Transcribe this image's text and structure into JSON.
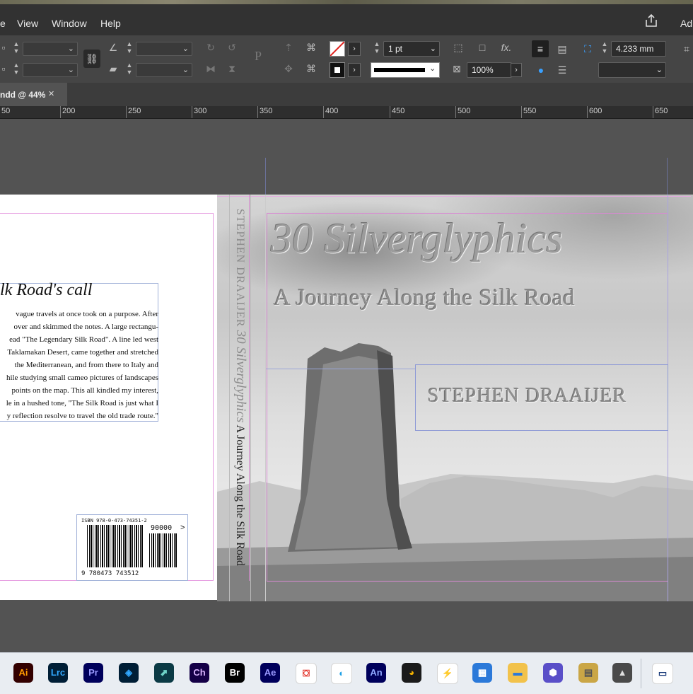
{
  "menu": {
    "item_e": "e",
    "view": "View",
    "window": "Window",
    "help": "Help",
    "ad": "Ad"
  },
  "control": {
    "stroke_weight": "1 pt",
    "opacity": "100%",
    "dimension": "4.233 mm"
  },
  "document_tab": {
    "title": "ndd @ 44%",
    "close": "✕"
  },
  "ruler": {
    "labels": [
      "50",
      "200",
      "250",
      "300",
      "350",
      "400",
      "450",
      "500",
      "550",
      "600",
      "650"
    ]
  },
  "back_cover": {
    "heading": "lk Road's call",
    "lines": [
      "vague travels at once took on a purpose. After",
      "over and skimmed the notes. A large rectangu-",
      "ead \"The Legendary Silk Road\". A line led west",
      "Taklamakan Desert, came together and stretched",
      "the Mediterranean, and from there to Italy and",
      "hile studying small cameo pictures of landscapes",
      "points on the map. This all kindled my interest,",
      "le in a hushed tone, \"The Silk Road is just what I",
      "y reflection resolve to travel the old trade route.\""
    ],
    "isbn_label": "ISBN 978-0-473-74351-2",
    "isbn_digits": "9 780473 743512",
    "price_code": "90000"
  },
  "spine": {
    "author": "STEPHEN DRAAIJER",
    "title_script": "30 Silverglyphics",
    "subtitle": "A Journey Along the Silk Road"
  },
  "front_cover": {
    "title": "30 Silverglyphics",
    "subtitle": "A Journey Along the Silk Road",
    "author": "STEPHEN DRAAIJER"
  },
  "taskbar": {
    "icons": [
      {
        "label": "Ai",
        "color": "#330000",
        "fg": "#ff9a00"
      },
      {
        "label": "Lrc",
        "color": "#001e36",
        "fg": "#31a8ff"
      },
      {
        "label": "Pr",
        "color": "#00005b",
        "fg": "#9999ff"
      },
      {
        "label": "◈",
        "color": "#001e36",
        "fg": "#31a8ff"
      },
      {
        "label": "⬈",
        "color": "#0b3a45",
        "fg": "#6fd3c8"
      },
      {
        "label": "Ch",
        "color": "#150047",
        "fg": "#d9b3ff"
      },
      {
        "label": "Br",
        "color": "#000000",
        "fg": "#ffffff"
      },
      {
        "label": "Ae",
        "color": "#00005b",
        "fg": "#9999ff"
      },
      {
        "label": "⛋",
        "color": "#ffffff",
        "fg": "#e1251b"
      },
      {
        "label": "◐",
        "color": "#ffffff",
        "fg": "#1ea0e6"
      },
      {
        "label": "An",
        "color": "#00005b",
        "fg": "#8fa8ff"
      },
      {
        "label": "◕",
        "color": "#1b1b1b",
        "fg": "#f5b300"
      },
      {
        "label": "⚡",
        "color": "#ffffff",
        "fg": "#f25a22"
      },
      {
        "label": "▦",
        "color": "#2b79d9",
        "fg": "#ffffff"
      },
      {
        "label": "▬",
        "color": "#f2c24b",
        "fg": "#2b79d9"
      },
      {
        "label": "⬢",
        "color": "#5a4fc8",
        "fg": "#ffffff"
      },
      {
        "label": "▤",
        "color": "#caa646",
        "fg": "#555555"
      },
      {
        "label": "▲",
        "color": "#4a4a4a",
        "fg": "#e0e0e0"
      },
      {
        "label": "▭",
        "color": "#ffffff",
        "fg": "#1a3b7a"
      }
    ]
  }
}
